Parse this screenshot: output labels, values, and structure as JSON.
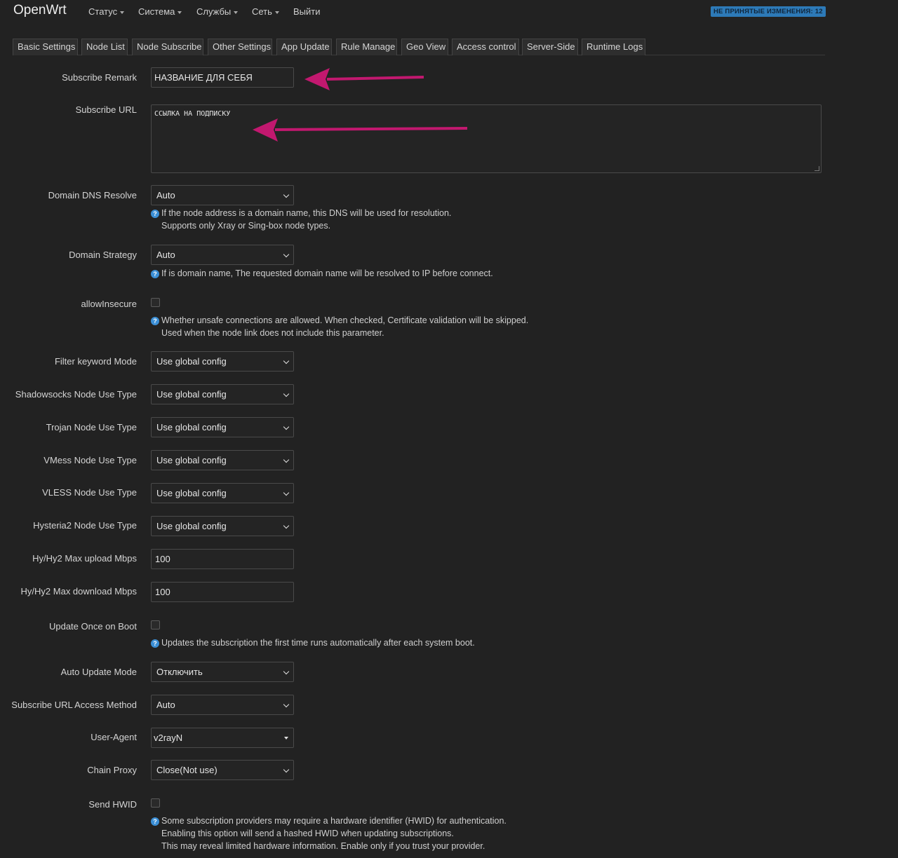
{
  "header": {
    "brand": "OpenWrt",
    "menu": [
      "Статус",
      "Система",
      "Службы",
      "Сеть",
      "Выйти"
    ],
    "badge": "НЕ ПРИНЯТЫЕ ИЗМЕНЕНИЯ: 12"
  },
  "tabs": [
    "Basic Settings",
    "Node List",
    "Node Subscribe",
    "Other Settings",
    "App Update",
    "Rule Manage",
    "Geo View",
    "Access control",
    "Server-Side",
    "Runtime Logs"
  ],
  "form": {
    "remark": {
      "label": "Subscribe Remark",
      "value": "НАЗВАНИЕ ДЛЯ СЕБЯ"
    },
    "url": {
      "label": "Subscribe URL",
      "value": "ССЫЛКА НА ПОДПИСКУ"
    },
    "dns": {
      "label": "Domain DNS Resolve",
      "value": "Auto",
      "help1": "If the node address is a domain name, this DNS will be used for resolution.",
      "help2": "Supports only Xray or Sing-box node types."
    },
    "strategy": {
      "label": "Domain Strategy",
      "value": "Auto",
      "help1": "If is domain name, The requested domain name will be resolved to IP before connect."
    },
    "insecure": {
      "label": "allowInsecure",
      "help1": "Whether unsafe connections are allowed. When checked, Certificate validation will be skipped.",
      "help2": "Used when the node link does not include this parameter."
    },
    "filter_mode": {
      "label": "Filter keyword Mode",
      "value": "Use global config"
    },
    "ss_type": {
      "label": "Shadowsocks Node Use Type",
      "value": "Use global config"
    },
    "trojan_type": {
      "label": "Trojan Node Use Type",
      "value": "Use global config"
    },
    "vmess_type": {
      "label": "VMess Node Use Type",
      "value": "Use global config"
    },
    "vless_type": {
      "label": "VLESS Node Use Type",
      "value": "Use global config"
    },
    "hy2_type": {
      "label": "Hysteria2 Node Use Type",
      "value": "Use global config"
    },
    "hy_up": {
      "label": "Hy/Hy2 Max upload Mbps",
      "value": "100"
    },
    "hy_down": {
      "label": "Hy/Hy2 Max download Mbps",
      "value": "100"
    },
    "boot_update": {
      "label": "Update Once on Boot",
      "help1": "Updates the subscription the first time runs automatically after each system boot."
    },
    "auto_update": {
      "label": "Auto Update Mode",
      "value": "Отключить"
    },
    "access_method": {
      "label": "Subscribe URL Access Method",
      "value": "Auto"
    },
    "user_agent": {
      "label": "User-Agent",
      "value": "v2rayN"
    },
    "chain_proxy": {
      "label": "Chain Proxy",
      "value": "Close(Not use)"
    },
    "hwid": {
      "label": "Send HWID",
      "help1": "Some subscription providers may require a hardware identifier (HWID) for authentication.",
      "help2": "Enabling this option will send a hashed HWID when updating subscriptions.",
      "help3": "This may reveal limited hardware information. Enable only if you trust your provider."
    }
  },
  "icons": {
    "help": "?",
    "help_icon_name": "help-circle-icon"
  },
  "colors": {
    "background": "#222222",
    "badge": "#2d7ab8",
    "annotation_arrow": "#c2186f",
    "help_icon": "#3b8fd6"
  }
}
